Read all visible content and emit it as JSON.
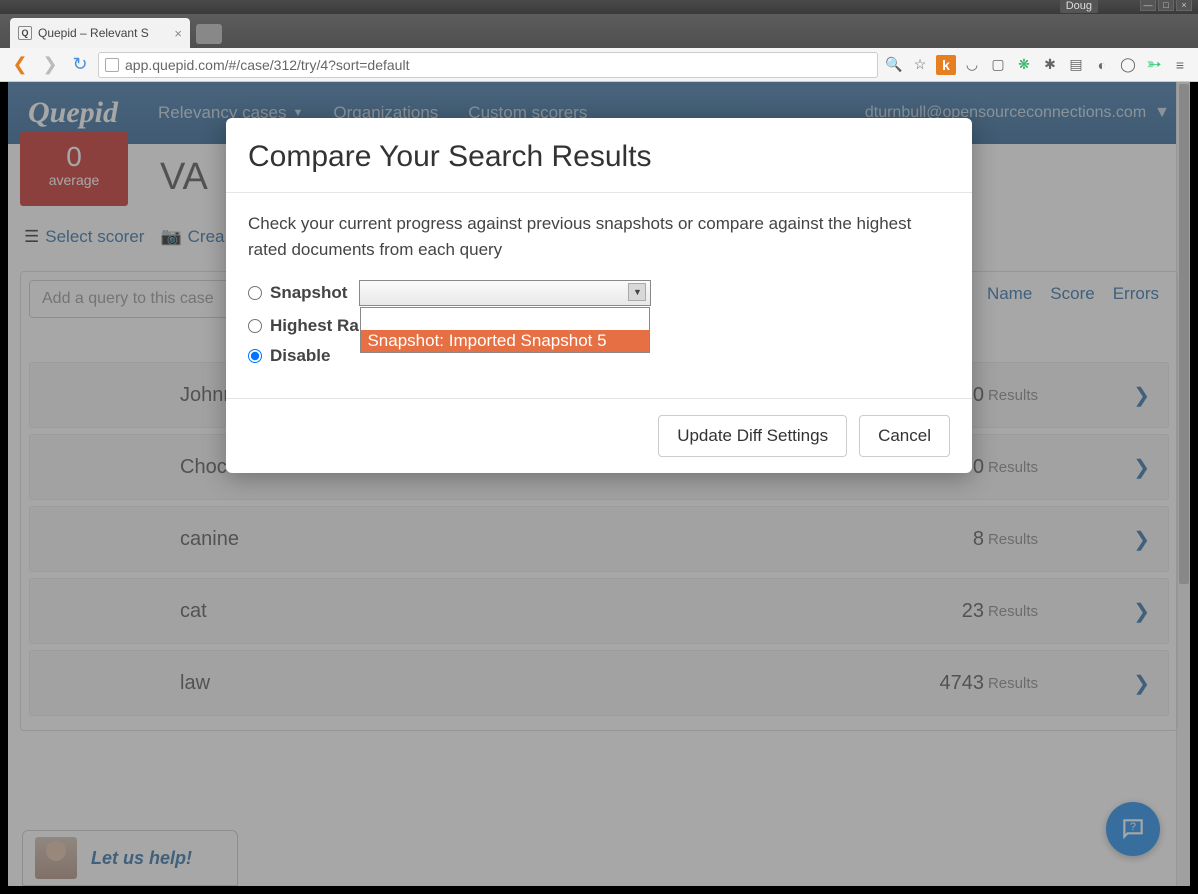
{
  "os": {
    "user": "Doug"
  },
  "browser": {
    "tab_title": "Quepid – Relevant S",
    "url": "app.quepid.com/#/case/312/try/4?sort=default"
  },
  "header": {
    "brand": "Quepid",
    "nav": {
      "cases": "Relevancy cases",
      "orgs": "Organizations",
      "scorers": "Custom scorers"
    },
    "user": "dturnbull@opensourceconnections.com"
  },
  "page": {
    "score_value": "0",
    "score_label": "average",
    "case_title": "VA",
    "select_scorer": "Select scorer",
    "create_snapshot": "Crea",
    "add_query_placeholder": "Add a query to this case",
    "columns": {
      "name": "Name",
      "score": "Score",
      "errors": "Errors"
    },
    "results_label": "Results",
    "queries": [
      {
        "name": "Johnn",
        "count": "0"
      },
      {
        "name": "Choco",
        "count": "0"
      },
      {
        "name": "canine",
        "count": "8"
      },
      {
        "name": "cat",
        "count": "23"
      },
      {
        "name": "law",
        "count": "4743"
      }
    ]
  },
  "modal": {
    "title": "Compare Your Search Results",
    "description": "Check your current progress against previous snapshots or compare against the highest rated documents from each query",
    "opt_snapshot": "Snapshot",
    "opt_highest": "Highest Ra",
    "opt_disable": "Disable",
    "dropdown_blank": "",
    "dropdown_option": "Snapshot: Imported Snapshot 5",
    "btn_update": "Update Diff Settings",
    "btn_cancel": "Cancel"
  },
  "help": {
    "text": "Let us help!"
  }
}
